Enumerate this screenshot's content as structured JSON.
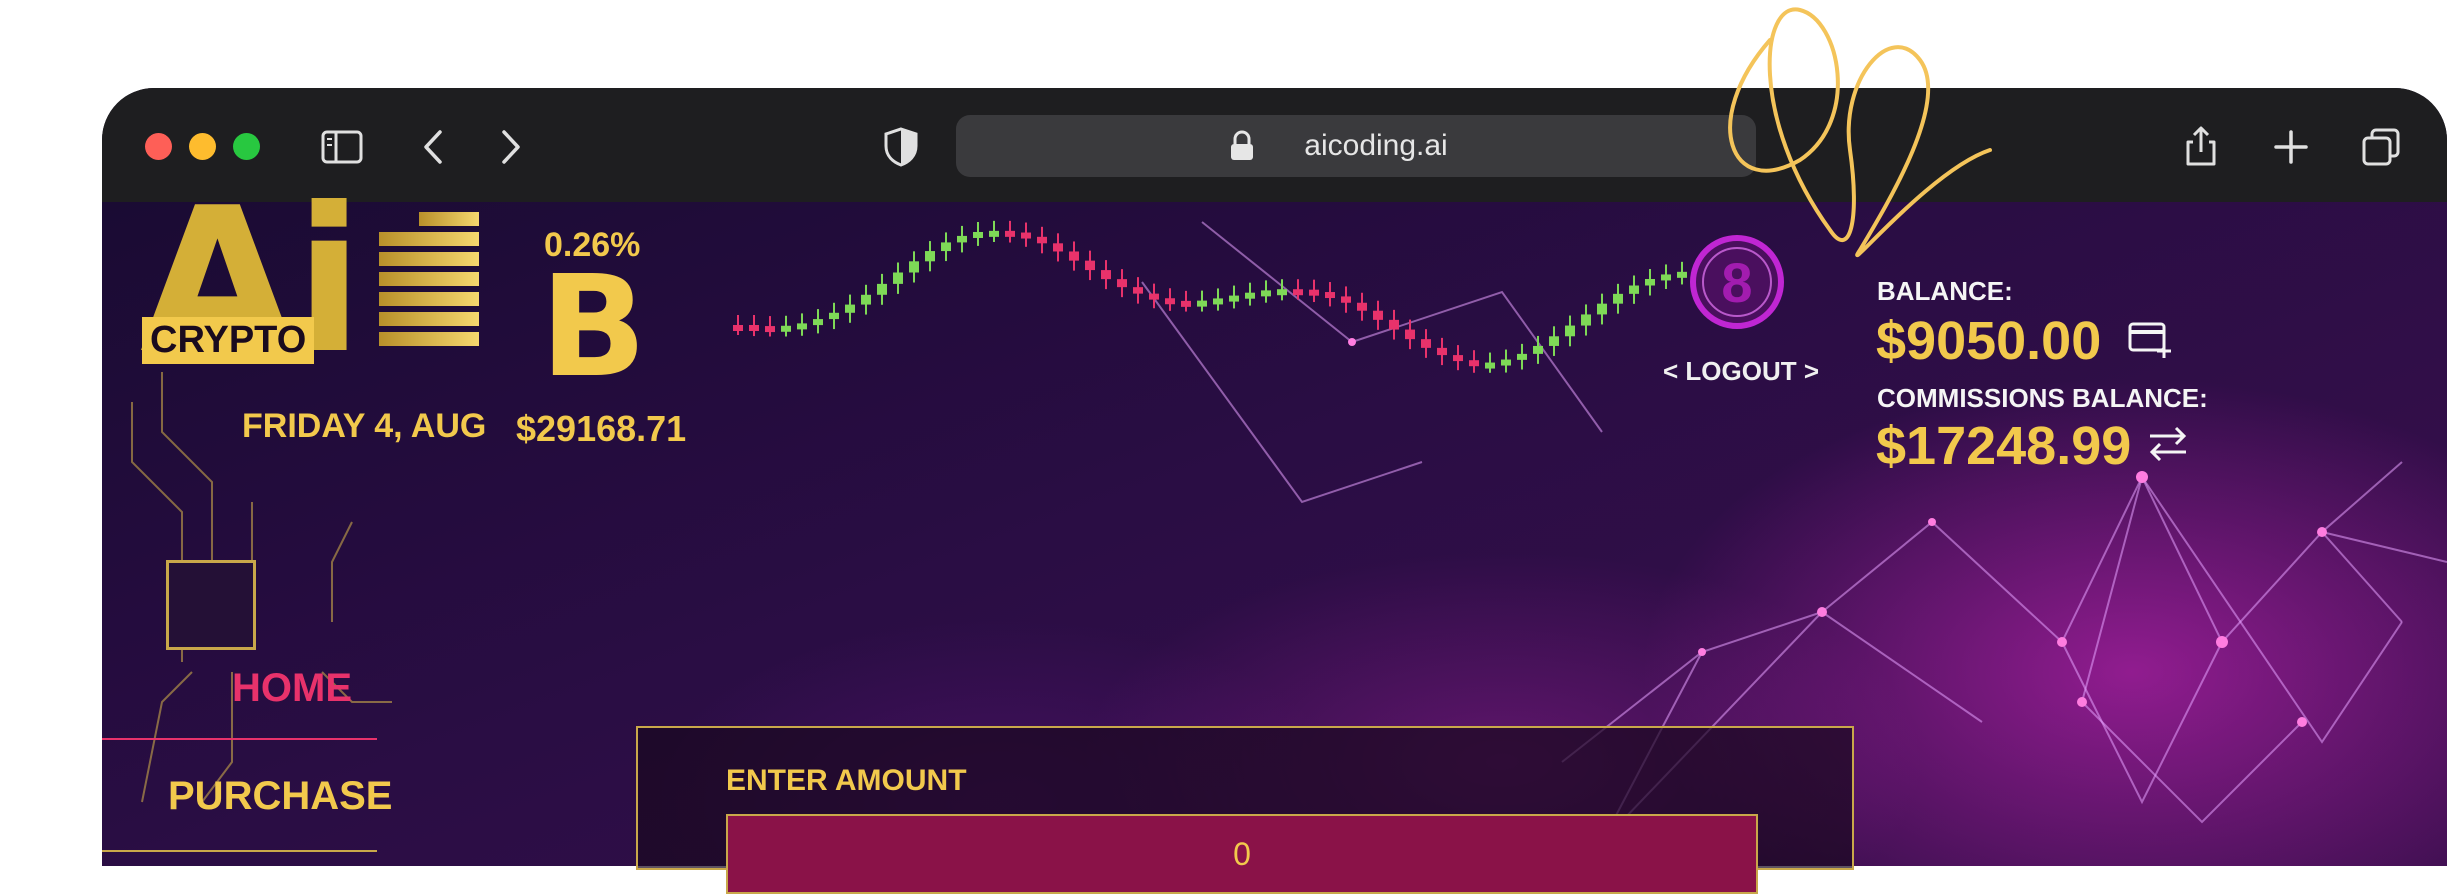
{
  "browser": {
    "url": "aicoding.ai",
    "icons": [
      "sidebar-icon",
      "back-icon",
      "forward-icon",
      "shield-icon",
      "lock-icon",
      "share-icon",
      "new-tab-icon",
      "tabs-overview-icon"
    ]
  },
  "brand": {
    "crypto_word": "CRYPTO"
  },
  "header": {
    "date": "FRIDAY 4, AUG",
    "btc_change": "0.26%",
    "btc_symbol": "B",
    "btc_price": "$29168.71",
    "logout_label": "< LOGOUT >",
    "logout_badge_number": "8"
  },
  "balances": {
    "balance_label": "BALANCE:",
    "balance_value": "$9050.00",
    "commissions_label": "COMMISSIONS BALANCE:",
    "commissions_value": "$17248.99"
  },
  "nav": {
    "home": "HOME",
    "purchase": "PURCHASE"
  },
  "form": {
    "enter_amount_label": "ENTER AMOUNT",
    "amount_value": "0"
  },
  "colors": {
    "gold": "#f2c94c",
    "pink": "#e8326b",
    "magenta": "#c026d3",
    "toolbar": "#1e1e20"
  }
}
